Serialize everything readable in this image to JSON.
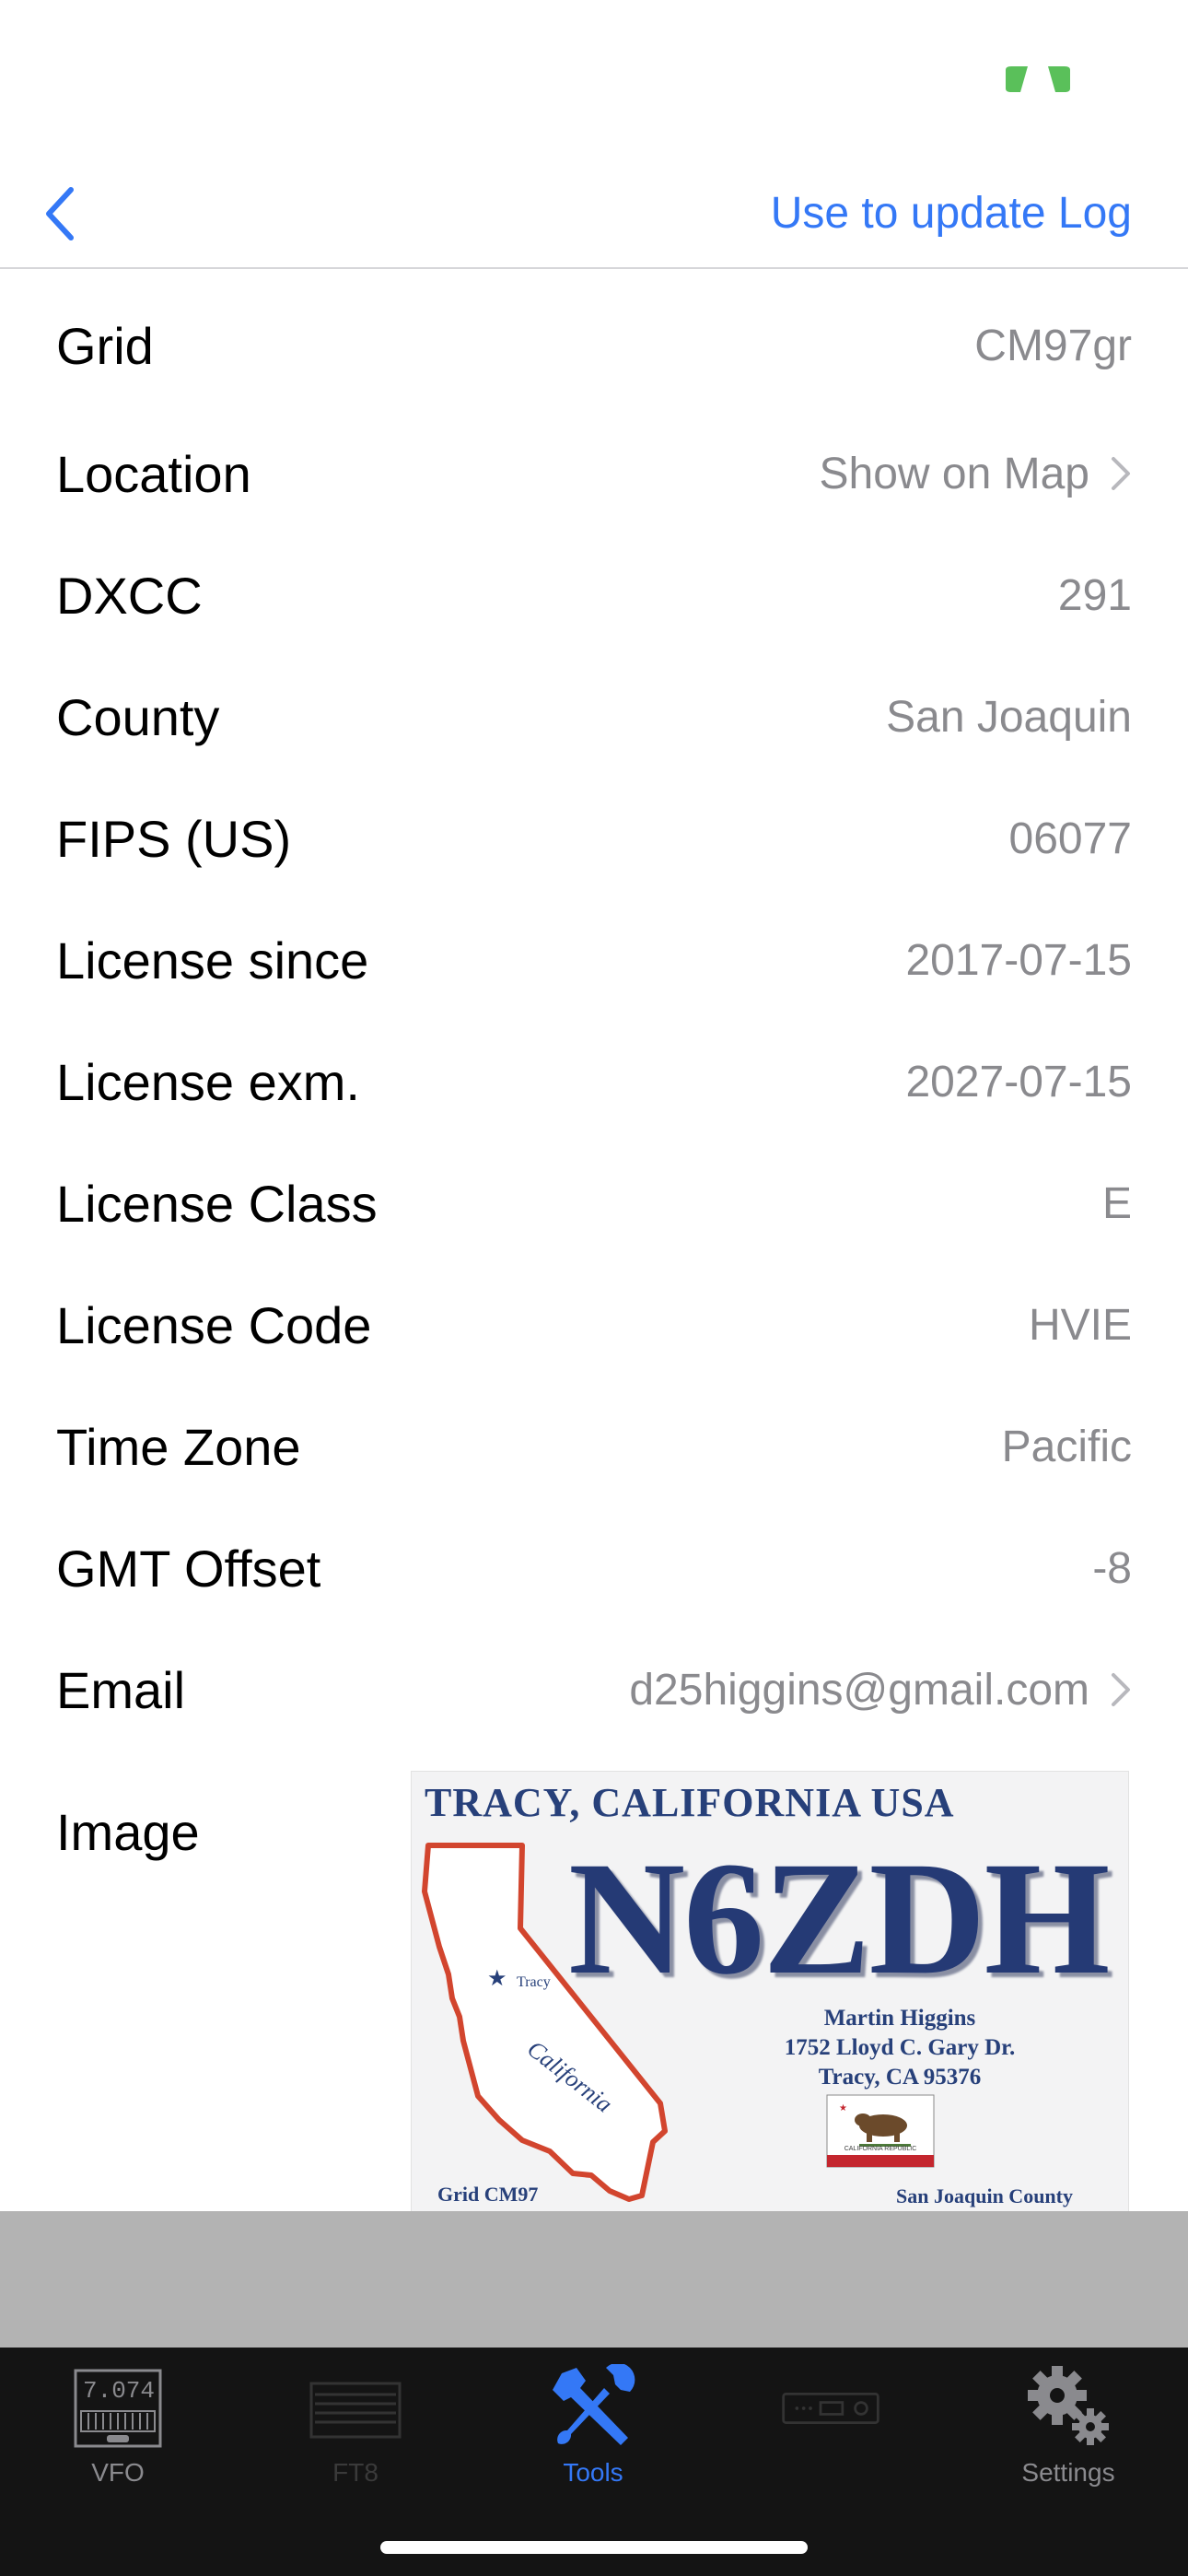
{
  "nav": {
    "back_icon": "chevron-left-icon",
    "update_log_label": "Use to update Log"
  },
  "status": {
    "icon": "activity-indicator-icon",
    "icon_color": "#5ac05a"
  },
  "rows": [
    {
      "label": "Grid",
      "value": "CM97gr",
      "chevron": false
    },
    {
      "label": "Location",
      "value": "Show on Map",
      "chevron": true
    },
    {
      "label": "DXCC",
      "value": "291",
      "chevron": false
    },
    {
      "label": "County",
      "value": "San Joaquin",
      "chevron": false
    },
    {
      "label": "FIPS (US)",
      "value": "06077",
      "chevron": false
    },
    {
      "label": "License since",
      "value": "2017-07-15",
      "chevron": false
    },
    {
      "label": "License exm.",
      "value": "2027-07-15",
      "chevron": false
    },
    {
      "label": "License Class",
      "value": "E",
      "chevron": false
    },
    {
      "label": "License Code",
      "value": "HVIE",
      "chevron": false
    },
    {
      "label": "Time Zone",
      "value": "Pacific",
      "chevron": false
    },
    {
      "label": "GMT Offset",
      "value": "-8",
      "chevron": false
    },
    {
      "label": "Email",
      "value": "d25higgins@gmail.com",
      "chevron": true
    }
  ],
  "image_row": {
    "label": "Image",
    "qsl": {
      "header": "TRACY, CALIFORNIA USA",
      "callsign": "N6ZDH",
      "name_line1": "Martin Higgins",
      "name_line2": "1752 Lloyd C. Gary Dr.",
      "name_line3": "Tracy, CA 95376",
      "grid": "Grid CM97",
      "county": "San Joaquin County",
      "map_city": "Tracy",
      "map_state": "California",
      "flag_text": "CALIFORNIA REPUBLIC"
    }
  },
  "tabs": [
    {
      "label": "VFO",
      "icon": "vfo-display-icon",
      "display_value": "7.074",
      "state": "normal"
    },
    {
      "label": "FT8",
      "icon": "ft8-waterfall-icon",
      "state": "disabled"
    },
    {
      "label": "Tools",
      "icon": "tools-icon",
      "state": "active"
    },
    {
      "label": "",
      "icon": "radio-device-icon",
      "state": "disabled"
    },
    {
      "label": "Settings",
      "icon": "gear-icon",
      "state": "normal"
    }
  ],
  "colors": {
    "accent": "#3478f6",
    "value_text": "#8a8a8e",
    "tab_bar_bg": "#141414",
    "band_gray": "#b3b3b3"
  }
}
